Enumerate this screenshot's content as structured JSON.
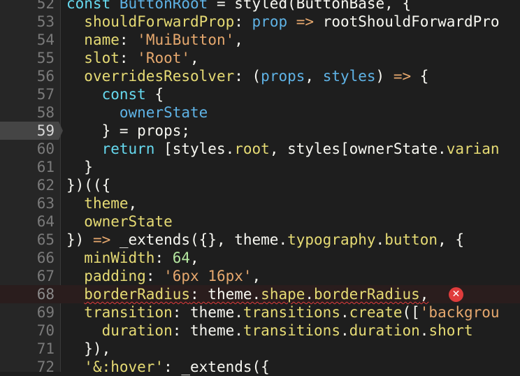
{
  "editor": {
    "lines": [
      {
        "num": "52",
        "tokens": [
          [
            "kw",
            "const "
          ],
          [
            "blue",
            "ButtonRoot"
          ],
          [
            "plain",
            " = styled(ButtonBase, {"
          ]
        ]
      },
      {
        "num": "53",
        "tokens": [
          [
            "plain",
            "  "
          ],
          [
            "prop",
            "shouldForwardProp"
          ],
          [
            "plain",
            ": "
          ],
          [
            "blue",
            "prop"
          ],
          [
            "plain",
            " "
          ],
          [
            "arrow",
            "=>"
          ],
          [
            "plain",
            " rootShouldForwardPro"
          ]
        ]
      },
      {
        "num": "54",
        "tokens": [
          [
            "plain",
            "  "
          ],
          [
            "prop",
            "name"
          ],
          [
            "plain",
            ": "
          ],
          [
            "str",
            "'MuiButton'"
          ],
          [
            "plain",
            ","
          ]
        ]
      },
      {
        "num": "55",
        "tokens": [
          [
            "plain",
            "  "
          ],
          [
            "prop",
            "slot"
          ],
          [
            "plain",
            ": "
          ],
          [
            "str",
            "'Root'"
          ],
          [
            "plain",
            ","
          ]
        ]
      },
      {
        "num": "56",
        "tokens": [
          [
            "plain",
            "  "
          ],
          [
            "prop",
            "overridesResolver"
          ],
          [
            "plain",
            ": ("
          ],
          [
            "blue",
            "props"
          ],
          [
            "plain",
            ", "
          ],
          [
            "blue",
            "styles"
          ],
          [
            "plain",
            ") "
          ],
          [
            "arrow",
            "=>"
          ],
          [
            "plain",
            " {"
          ]
        ]
      },
      {
        "num": "57",
        "tokens": [
          [
            "plain",
            "    "
          ],
          [
            "kw",
            "const"
          ],
          [
            "plain",
            " {"
          ]
        ]
      },
      {
        "num": "58",
        "tokens": [
          [
            "plain",
            "      "
          ],
          [
            "blue",
            "ownerState"
          ]
        ]
      },
      {
        "num": "59",
        "tokens": [
          [
            "plain",
            "    } = props;"
          ]
        ]
      },
      {
        "num": "60",
        "tokens": [
          [
            "plain",
            "    "
          ],
          [
            "kw",
            "return"
          ],
          [
            "plain",
            " [styles."
          ],
          [
            "prop",
            "root"
          ],
          [
            "plain",
            ", styles[ownerState."
          ],
          [
            "prop",
            "varian"
          ]
        ]
      },
      {
        "num": "61",
        "tokens": [
          [
            "plain",
            "  }"
          ]
        ]
      },
      {
        "num": "62",
        "tokens": [
          [
            "plain",
            "})(({"
          ]
        ]
      },
      {
        "num": "63",
        "tokens": [
          [
            "plain",
            "  "
          ],
          [
            "prop",
            "theme"
          ],
          [
            "plain",
            ","
          ]
        ]
      },
      {
        "num": "64",
        "tokens": [
          [
            "plain",
            "  "
          ],
          [
            "prop",
            "ownerState"
          ]
        ]
      },
      {
        "num": "65",
        "tokens": [
          [
            "plain",
            "}) "
          ],
          [
            "arrow",
            "=>"
          ],
          [
            "plain",
            " _extends({}, theme."
          ],
          [
            "prop",
            "typography"
          ],
          [
            "plain",
            "."
          ],
          [
            "prop",
            "button"
          ],
          [
            "plain",
            ", {"
          ]
        ]
      },
      {
        "num": "66",
        "tokens": [
          [
            "plain",
            "  "
          ],
          [
            "prop",
            "minWidth"
          ],
          [
            "plain",
            ": "
          ],
          [
            "num",
            "64"
          ],
          [
            "plain",
            ","
          ]
        ]
      },
      {
        "num": "67",
        "tokens": [
          [
            "plain",
            "  "
          ],
          [
            "prop",
            "padding"
          ],
          [
            "plain",
            ": "
          ],
          [
            "str",
            "'6px 16px'"
          ],
          [
            "plain",
            ","
          ]
        ]
      },
      {
        "num": "68",
        "tokens": [
          [
            "plain",
            "  "
          ],
          [
            "prop",
            "borderRadius"
          ],
          [
            "plain",
            ": theme."
          ],
          [
            "prop",
            "shape"
          ],
          [
            "plain",
            "."
          ],
          [
            "prop",
            "borderRadius"
          ],
          [
            "plain",
            ","
          ]
        ]
      },
      {
        "num": "69",
        "tokens": [
          [
            "plain",
            "  "
          ],
          [
            "prop",
            "transition"
          ],
          [
            "plain",
            ": theme."
          ],
          [
            "prop",
            "transitions"
          ],
          [
            "plain",
            "."
          ],
          [
            "prop",
            "create"
          ],
          [
            "plain",
            "(["
          ],
          [
            "str",
            "'backgrou"
          ]
        ]
      },
      {
        "num": "70",
        "tokens": [
          [
            "plain",
            "    "
          ],
          [
            "prop",
            "duration"
          ],
          [
            "plain",
            ": theme."
          ],
          [
            "prop",
            "transitions"
          ],
          [
            "plain",
            "."
          ],
          [
            "prop",
            "duration"
          ],
          [
            "plain",
            "."
          ],
          [
            "prop",
            "short"
          ]
        ]
      },
      {
        "num": "71",
        "tokens": [
          [
            "plain",
            "  }),"
          ]
        ]
      },
      {
        "num": "72",
        "tokens": [
          [
            "plain",
            "  "
          ],
          [
            "prop",
            "'&:hover'"
          ],
          [
            "plain",
            ": _extends({"
          ]
        ]
      }
    ],
    "active_line": "59",
    "error_line": "68",
    "error_icon_glyph": "✕"
  },
  "colors": {
    "background": "#1e1e1e",
    "gutter": "#262626",
    "error": "#e03c3c"
  }
}
